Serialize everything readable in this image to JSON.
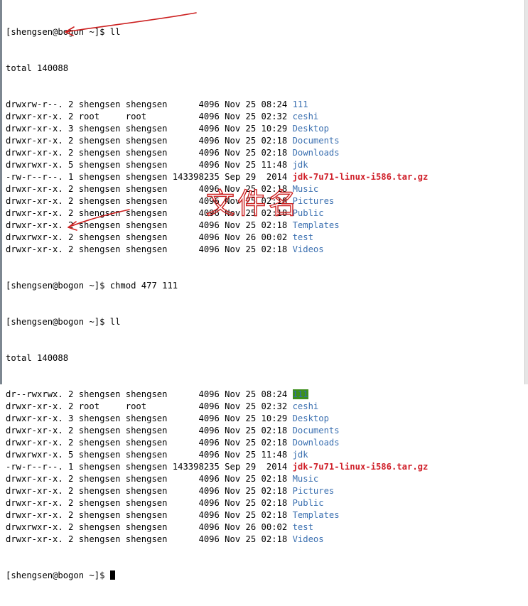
{
  "colors": {
    "background": "#ffffff",
    "text": "#000000",
    "directory": "#3a6fb0",
    "archive": "#d0202a",
    "highlight_bg": "#3d8f1c",
    "annotation": "#cc2020"
  },
  "session": {
    "prompt1": "[shengsen@bogon ~]$ ll",
    "total1": "total 140088",
    "listing1": [
      {
        "perms": "drwxrw-r--. 2 shengsen shengsen      4096 Nov 25 08:24 ",
        "name": "111",
        "kind": "dir"
      },
      {
        "perms": "drwxr-xr-x. 2 root     root          4096 Nov 25 02:32 ",
        "name": "ceshi",
        "kind": "dir"
      },
      {
        "perms": "drwxr-xr-x. 3 shengsen shengsen      4096 Nov 25 10:29 ",
        "name": "Desktop",
        "kind": "dir"
      },
      {
        "perms": "drwxr-xr-x. 2 shengsen shengsen      4096 Nov 25 02:18 ",
        "name": "Documents",
        "kind": "dir"
      },
      {
        "perms": "drwxr-xr-x. 2 shengsen shengsen      4096 Nov 25 02:18 ",
        "name": "Downloads",
        "kind": "dir"
      },
      {
        "perms": "drwxrwxr-x. 5 shengsen shengsen      4096 Nov 25 11:48 ",
        "name": "jdk",
        "kind": "dir"
      },
      {
        "perms": "-rw-r--r--. 1 shengsen shengsen 143398235 Sep 29  2014 ",
        "name": "jdk-7u71-linux-i586.tar.gz",
        "kind": "archive"
      },
      {
        "perms": "drwxr-xr-x. 2 shengsen shengsen      4096 Nov 25 02:18 ",
        "name": "Music",
        "kind": "dir"
      },
      {
        "perms": "drwxr-xr-x. 2 shengsen shengsen      4096 Nov 25 02:18 ",
        "name": "Pictures",
        "kind": "dir"
      },
      {
        "perms": "drwxr-xr-x. 2 shengsen shengsen      4096 Nov 25 02:18 ",
        "name": "Public",
        "kind": "dir"
      },
      {
        "perms": "drwxr-xr-x. 2 shengsen shengsen      4096 Nov 25 02:18 ",
        "name": "Templates",
        "kind": "dir"
      },
      {
        "perms": "drwxrwxr-x. 2 shengsen shengsen      4096 Nov 26 00:02 ",
        "name": "test",
        "kind": "dir"
      },
      {
        "perms": "drwxr-xr-x. 2 shengsen shengsen      4096 Nov 25 02:18 ",
        "name": "Videos",
        "kind": "dir"
      }
    ],
    "command2": "[shengsen@bogon ~]$ chmod 477 111",
    "prompt2": "[shengsen@bogon ~]$ ll",
    "total2": "total 140088",
    "listing2": [
      {
        "perms": "dr--rwxrwx. 2 shengsen shengsen      4096 Nov 25 08:24 ",
        "name": "111",
        "kind": "highlight"
      },
      {
        "perms": "drwxr-xr-x. 2 root     root          4096 Nov 25 02:32 ",
        "name": "ceshi",
        "kind": "dir"
      },
      {
        "perms": "drwxr-xr-x. 3 shengsen shengsen      4096 Nov 25 10:29 ",
        "name": "Desktop",
        "kind": "dir"
      },
      {
        "perms": "drwxr-xr-x. 2 shengsen shengsen      4096 Nov 25 02:18 ",
        "name": "Documents",
        "kind": "dir"
      },
      {
        "perms": "drwxr-xr-x. 2 shengsen shengsen      4096 Nov 25 02:18 ",
        "name": "Downloads",
        "kind": "dir"
      },
      {
        "perms": "drwxrwxr-x. 5 shengsen shengsen      4096 Nov 25 11:48 ",
        "name": "jdk",
        "kind": "dir"
      },
      {
        "perms": "-rw-r--r--. 1 shengsen shengsen 143398235 Sep 29  2014 ",
        "name": "jdk-7u71-linux-i586.tar.gz",
        "kind": "archive"
      },
      {
        "perms": "drwxr-xr-x. 2 shengsen shengsen      4096 Nov 25 02:18 ",
        "name": "Music",
        "kind": "dir"
      },
      {
        "perms": "drwxr-xr-x. 2 shengsen shengsen      4096 Nov 25 02:18 ",
        "name": "Pictures",
        "kind": "dir"
      },
      {
        "perms": "drwxr-xr-x. 2 shengsen shengsen      4096 Nov 25 02:18 ",
        "name": "Public",
        "kind": "dir"
      },
      {
        "perms": "drwxr-xr-x. 2 shengsen shengsen      4096 Nov 25 02:18 ",
        "name": "Templates",
        "kind": "dir"
      },
      {
        "perms": "drwxrwxr-x. 2 shengsen shengsen      4096 Nov 26 00:02 ",
        "name": "test",
        "kind": "dir"
      },
      {
        "perms": "drwxr-xr-x. 2 shengsen shengsen      4096 Nov 25 02:18 ",
        "name": "Videos",
        "kind": "dir"
      }
    ],
    "prompt3": "[shengsen@bogon ~]$ "
  },
  "annotation": {
    "handwritten_note": "文件名"
  }
}
